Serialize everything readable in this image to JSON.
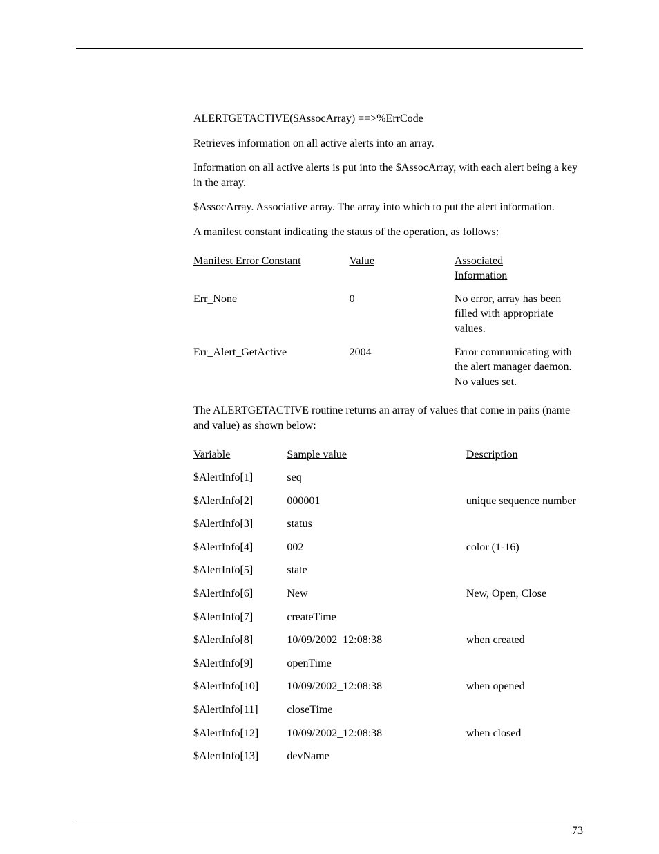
{
  "syntax": "ALERTGETACTIVE($AssocArray) ==>%ErrCode",
  "p1": "Retrieves information on all active alerts into an array.",
  "p2": "Information on all active alerts is put into the $AssocArray, with each alert being a key in the array.",
  "p3": "$AssocArray. Associative array.  The array into which to put the alert information.",
  "p4": "A manifest constant indicating the status of the operation, as follows:",
  "table1": {
    "head": {
      "c1": "Manifest Error Constant",
      "c2": "Value",
      "c3a": "Associated",
      "c3b": "Information"
    },
    "rows": [
      {
        "c1": "Err_None",
        "c2": "0",
        "c3": "No error, array has been filled with appropriate values."
      },
      {
        "c1": "Err_Alert_GetActive",
        "c2": "2004",
        "c3": "Error communicating with the alert manager daemon.  No values set."
      }
    ]
  },
  "p5": "The ALERTGETACTIVE routine returns an array of values that come in pairs (name and value) as shown below:",
  "table2": {
    "head": {
      "c1": "Variable",
      "c2": "Sample value",
      "c3": "Description"
    },
    "rows": [
      {
        "c1": "$AlertInfo[1]",
        "c2": "seq",
        "c3": ""
      },
      {
        "c1": "$AlertInfo[2]",
        "c2": "000001",
        "c3": "unique sequence number"
      },
      {
        "c1": "$AlertInfo[3]",
        "c2": "status",
        "c3": ""
      },
      {
        "c1": "$AlertInfo[4]",
        "c2": "002",
        "c3": "color (1-16)"
      },
      {
        "c1": "$AlertInfo[5]",
        "c2": "state",
        "c3": ""
      },
      {
        "c1": "$AlertInfo[6]",
        "c2": "New",
        "c3": "New, Open, Close"
      },
      {
        "c1": "$AlertInfo[7]",
        "c2": "createTime",
        "c3": ""
      },
      {
        "c1": "$AlertInfo[8]",
        "c2": "10/09/2002_12:08:38",
        "c3": "when created"
      },
      {
        "c1": "$AlertInfo[9]",
        "c2": "openTime",
        "c3": ""
      },
      {
        "c1": "$AlertInfo[10]",
        "c2": "10/09/2002_12:08:38",
        "c3": "when opened"
      },
      {
        "c1": "$AlertInfo[11]",
        "c2": "closeTime",
        "c3": ""
      },
      {
        "c1": "$AlertInfo[12]",
        "c2": "10/09/2002_12:08:38",
        "c3": "when closed"
      },
      {
        "c1": "$AlertInfo[13]",
        "c2": "devName",
        "c3": ""
      }
    ]
  },
  "pagenum": "73"
}
